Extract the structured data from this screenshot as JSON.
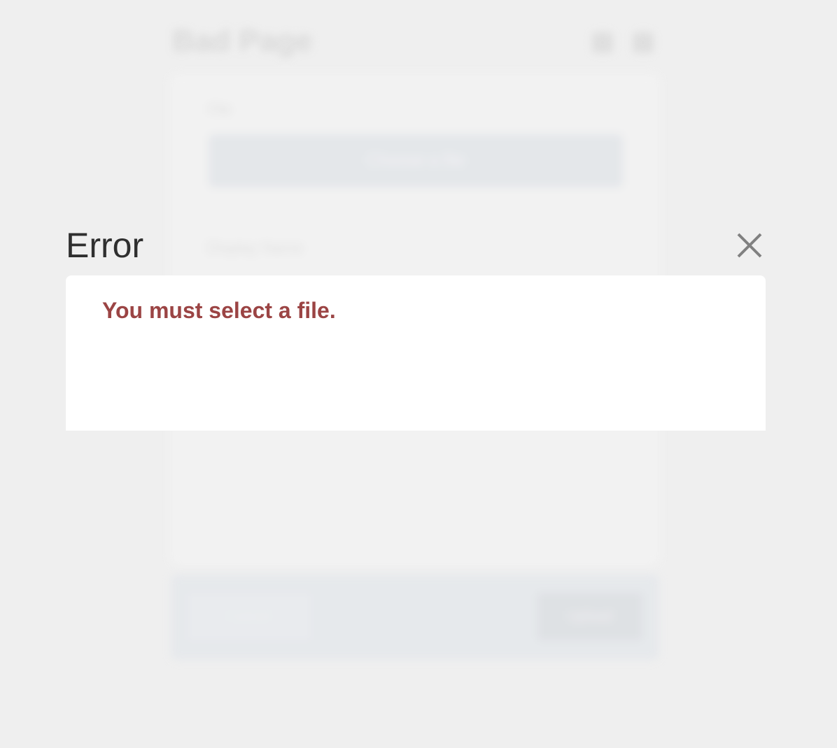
{
  "background": {
    "title": "Bad Page",
    "file_label": "File",
    "choose_button": "Choose a file",
    "name_label": "Display Name",
    "cancel_button": "Cancel",
    "upload_button": "Upload"
  },
  "modal": {
    "title": "Error",
    "message": "You must select a file.",
    "close_icon": "close-icon"
  },
  "colors": {
    "page_background": "#efefef",
    "error_text": "#9b4444",
    "title_text": "#2f2f2f",
    "close_icon": "#808080"
  }
}
